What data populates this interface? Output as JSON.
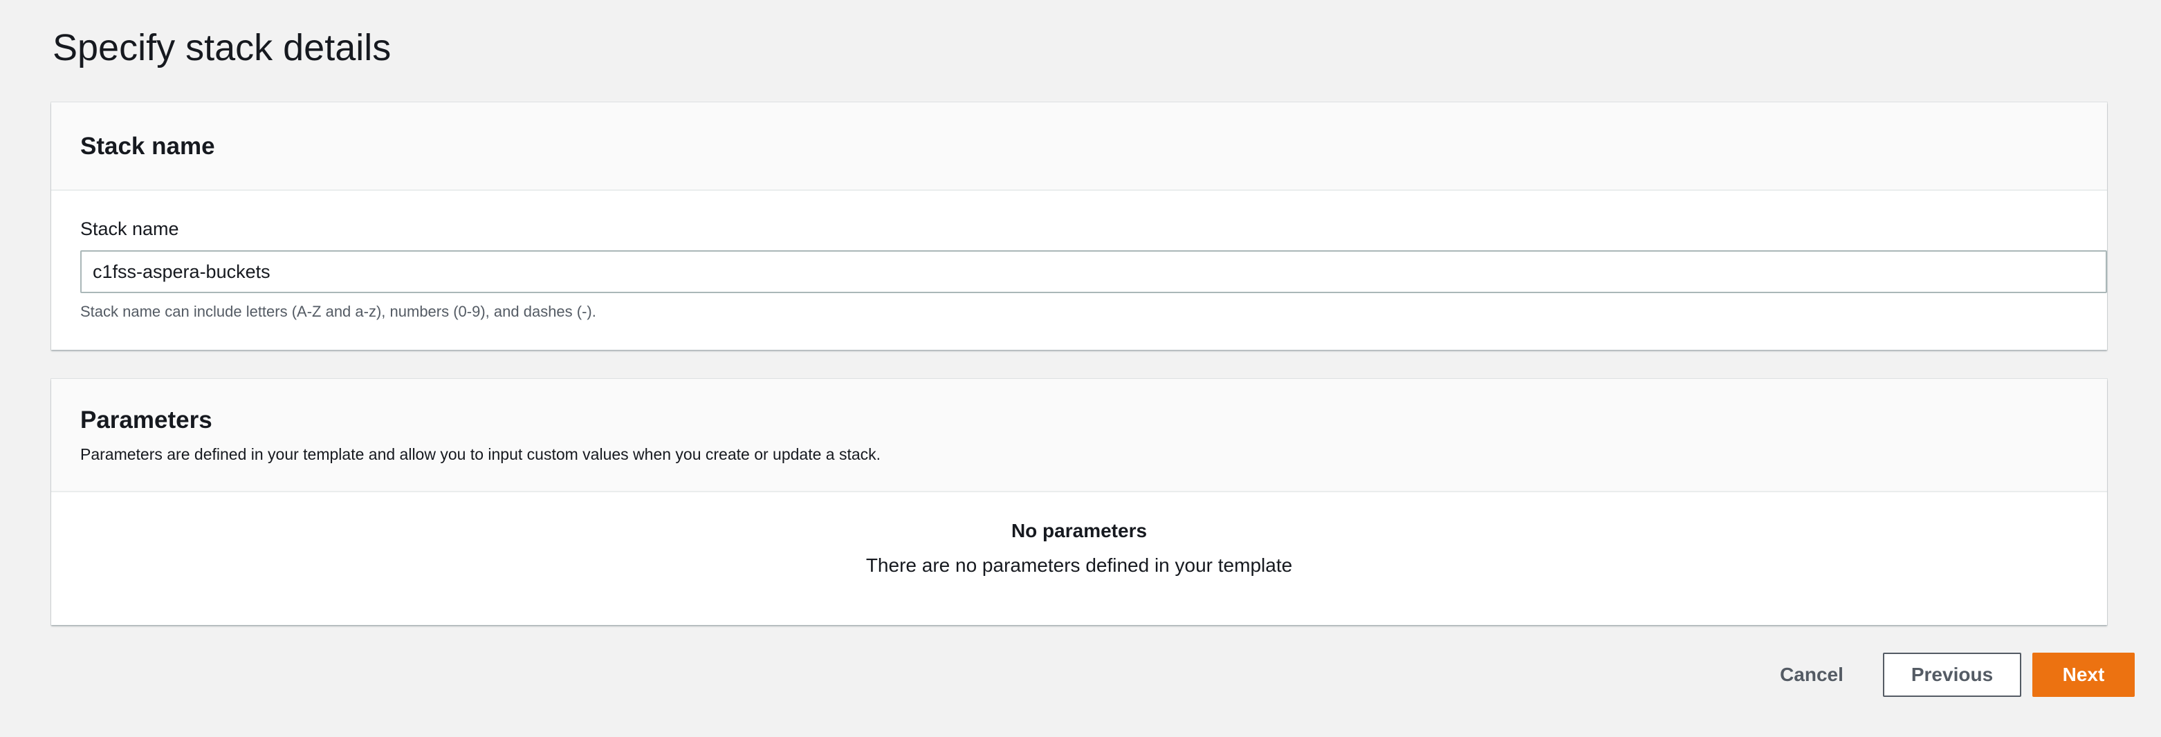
{
  "page": {
    "title": "Specify stack details"
  },
  "stack_name_section": {
    "header": "Stack name",
    "field_label": "Stack name",
    "field_value": "c1fss-aspera-buckets",
    "hint": "Stack name can include letters (A-Z and a-z), numbers (0-9), and dashes (-)."
  },
  "parameters_section": {
    "header": "Parameters",
    "description": "Parameters are defined in your template and allow you to input custom values when you create or update a stack.",
    "empty_title": "No parameters",
    "empty_description": "There are no parameters defined in your template"
  },
  "footer": {
    "cancel_label": "Cancel",
    "previous_label": "Previous",
    "next_label": "Next"
  },
  "colors": {
    "background": "#f2f2f2",
    "panel_header": "#fafafa",
    "primary_button": "#ec7211",
    "text": "#16191f",
    "secondary_text": "#545b64"
  }
}
